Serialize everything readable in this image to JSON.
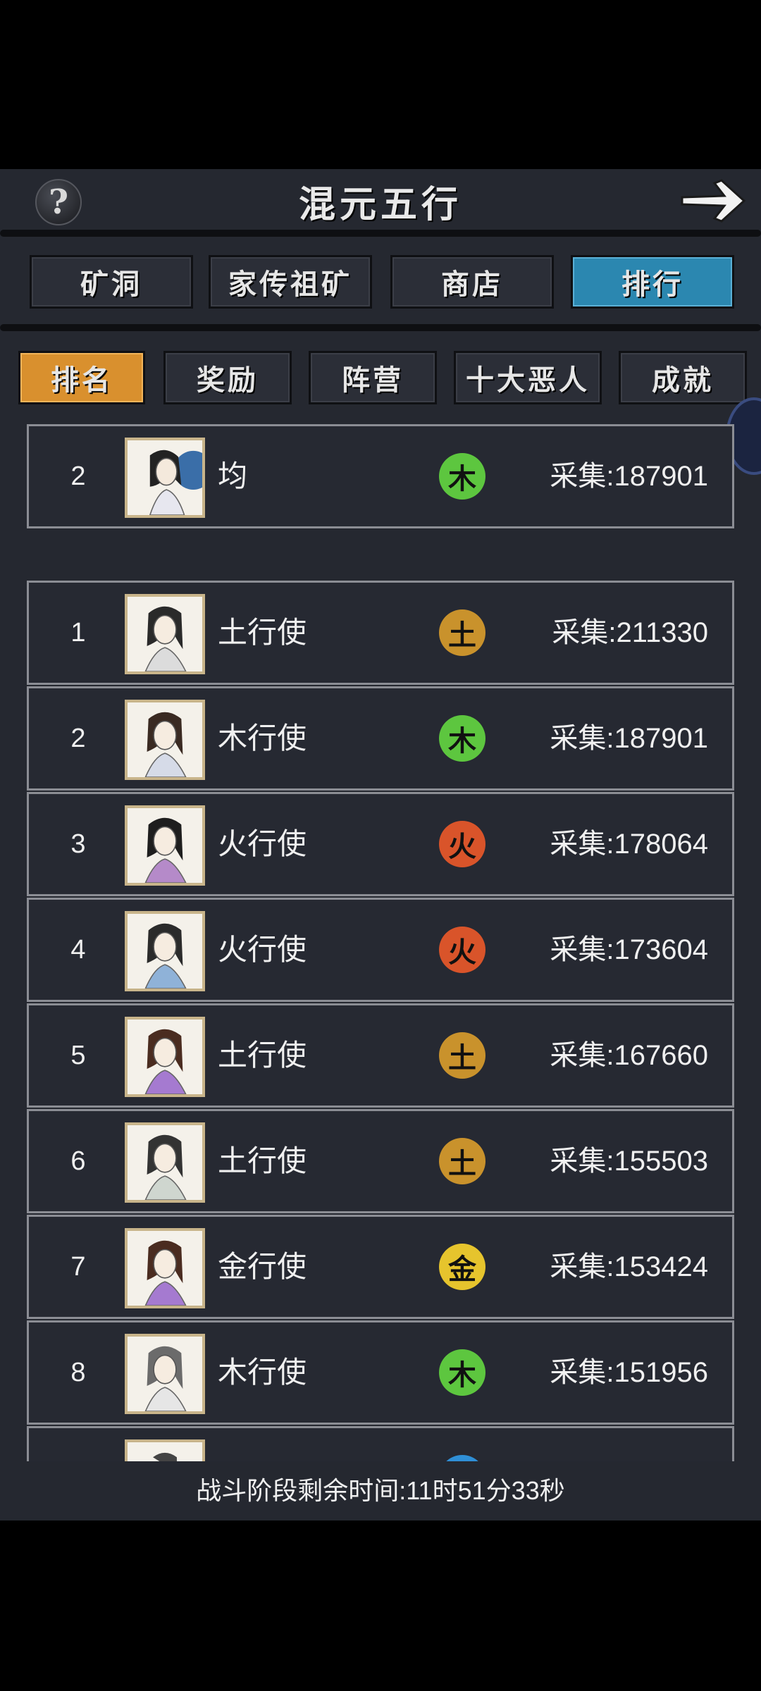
{
  "header": {
    "title": "混元五行",
    "help_icon": "question-icon",
    "back_icon": "arrow-right-icon"
  },
  "main_tabs": [
    {
      "label": "矿洞",
      "active": false
    },
    {
      "label": "家传祖矿",
      "active": false
    },
    {
      "label": "商店",
      "active": false
    },
    {
      "label": "排行",
      "active": true
    }
  ],
  "sub_tabs": [
    {
      "label": "排名",
      "active": true
    },
    {
      "label": "奖励",
      "active": false
    },
    {
      "label": "阵营",
      "active": false
    },
    {
      "label": "十大恶人",
      "active": false
    },
    {
      "label": "成就",
      "active": false
    }
  ],
  "colors": {
    "earth": "#c9922c",
    "wood": "#5dc63f",
    "fire": "#d9542a",
    "metal": "#e6c42d",
    "water": "#2f8fd6",
    "active_main_tab": "#2b87b0",
    "active_sub_tab": "#d9902e"
  },
  "my_rank": {
    "rank": "2",
    "name": "均",
    "element": "木",
    "element_color": "#5dc63f",
    "score": "采集:187901"
  },
  "rankings": [
    {
      "rank": "1",
      "name": "土行使",
      "element": "土",
      "element_color": "#c9922c",
      "score": "采集:211330"
    },
    {
      "rank": "2",
      "name": "木行使",
      "element": "木",
      "element_color": "#5dc63f",
      "score": "采集:187901"
    },
    {
      "rank": "3",
      "name": "火行使",
      "element": "火",
      "element_color": "#d9542a",
      "score": "采集:178064"
    },
    {
      "rank": "4",
      "name": "火行使",
      "element": "火",
      "element_color": "#d9542a",
      "score": "采集:173604"
    },
    {
      "rank": "5",
      "name": "土行使",
      "element": "土",
      "element_color": "#c9922c",
      "score": "采集:167660"
    },
    {
      "rank": "6",
      "name": "土行使",
      "element": "土",
      "element_color": "#c9922c",
      "score": "采集:155503"
    },
    {
      "rank": "7",
      "name": "金行使",
      "element": "金",
      "element_color": "#e6c42d",
      "score": "采集:153424"
    },
    {
      "rank": "8",
      "name": "木行使",
      "element": "木",
      "element_color": "#5dc63f",
      "score": "采集:151956"
    }
  ],
  "footer": {
    "countdown": "战斗阶段剩余时间:11时51分33秒"
  }
}
